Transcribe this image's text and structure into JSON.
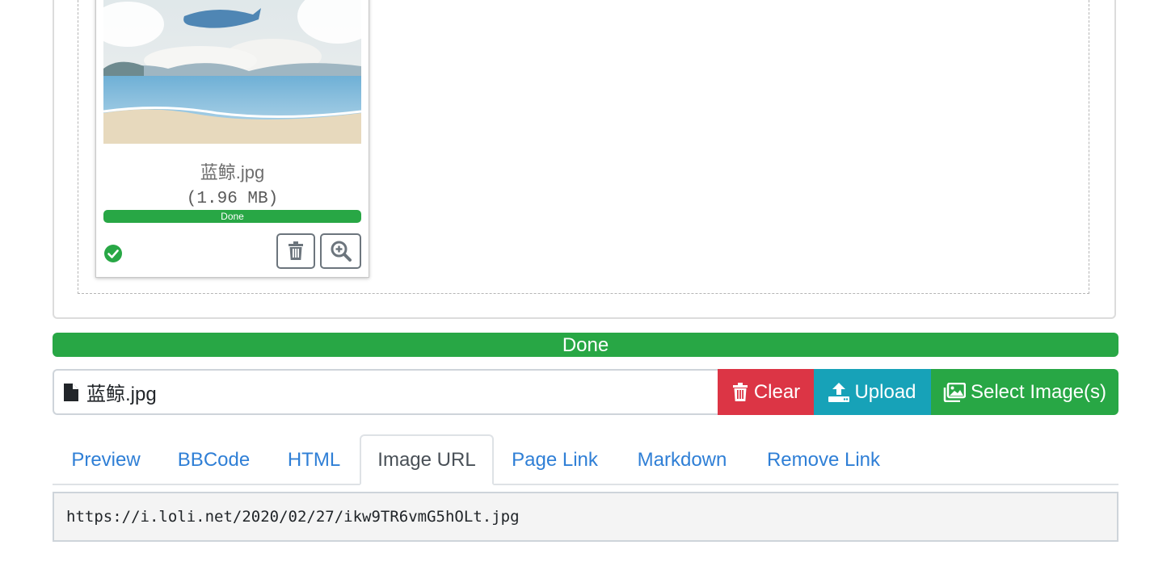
{
  "preview": {
    "file_name": "蓝鲸.jpg",
    "file_size": "(1.96 MB)",
    "progress_label": "Done",
    "progress_fraction": 1.0,
    "status": "success"
  },
  "upload_progress": {
    "label": "Done",
    "fraction": 1.0
  },
  "file_input": {
    "value": "蓝鲸.jpg"
  },
  "buttons": {
    "clear": "Clear",
    "upload": "Upload",
    "select": "Select Image(s)"
  },
  "tabs": [
    {
      "label": "Preview",
      "active": false
    },
    {
      "label": "BBCode",
      "active": false
    },
    {
      "label": "HTML",
      "active": false
    },
    {
      "label": "Image URL",
      "active": true
    },
    {
      "label": "Page Link",
      "active": false
    },
    {
      "label": "Markdown",
      "active": false
    },
    {
      "label": "Remove Link",
      "active": false
    }
  ],
  "result": {
    "value": "https://i.loli.net/2020/02/27/ikw9TR6vmG5hOLt.jpg"
  },
  "colors": {
    "success": "#28a745",
    "danger": "#dc3545",
    "info": "#17a2b8",
    "link": "#2f7fd6"
  }
}
